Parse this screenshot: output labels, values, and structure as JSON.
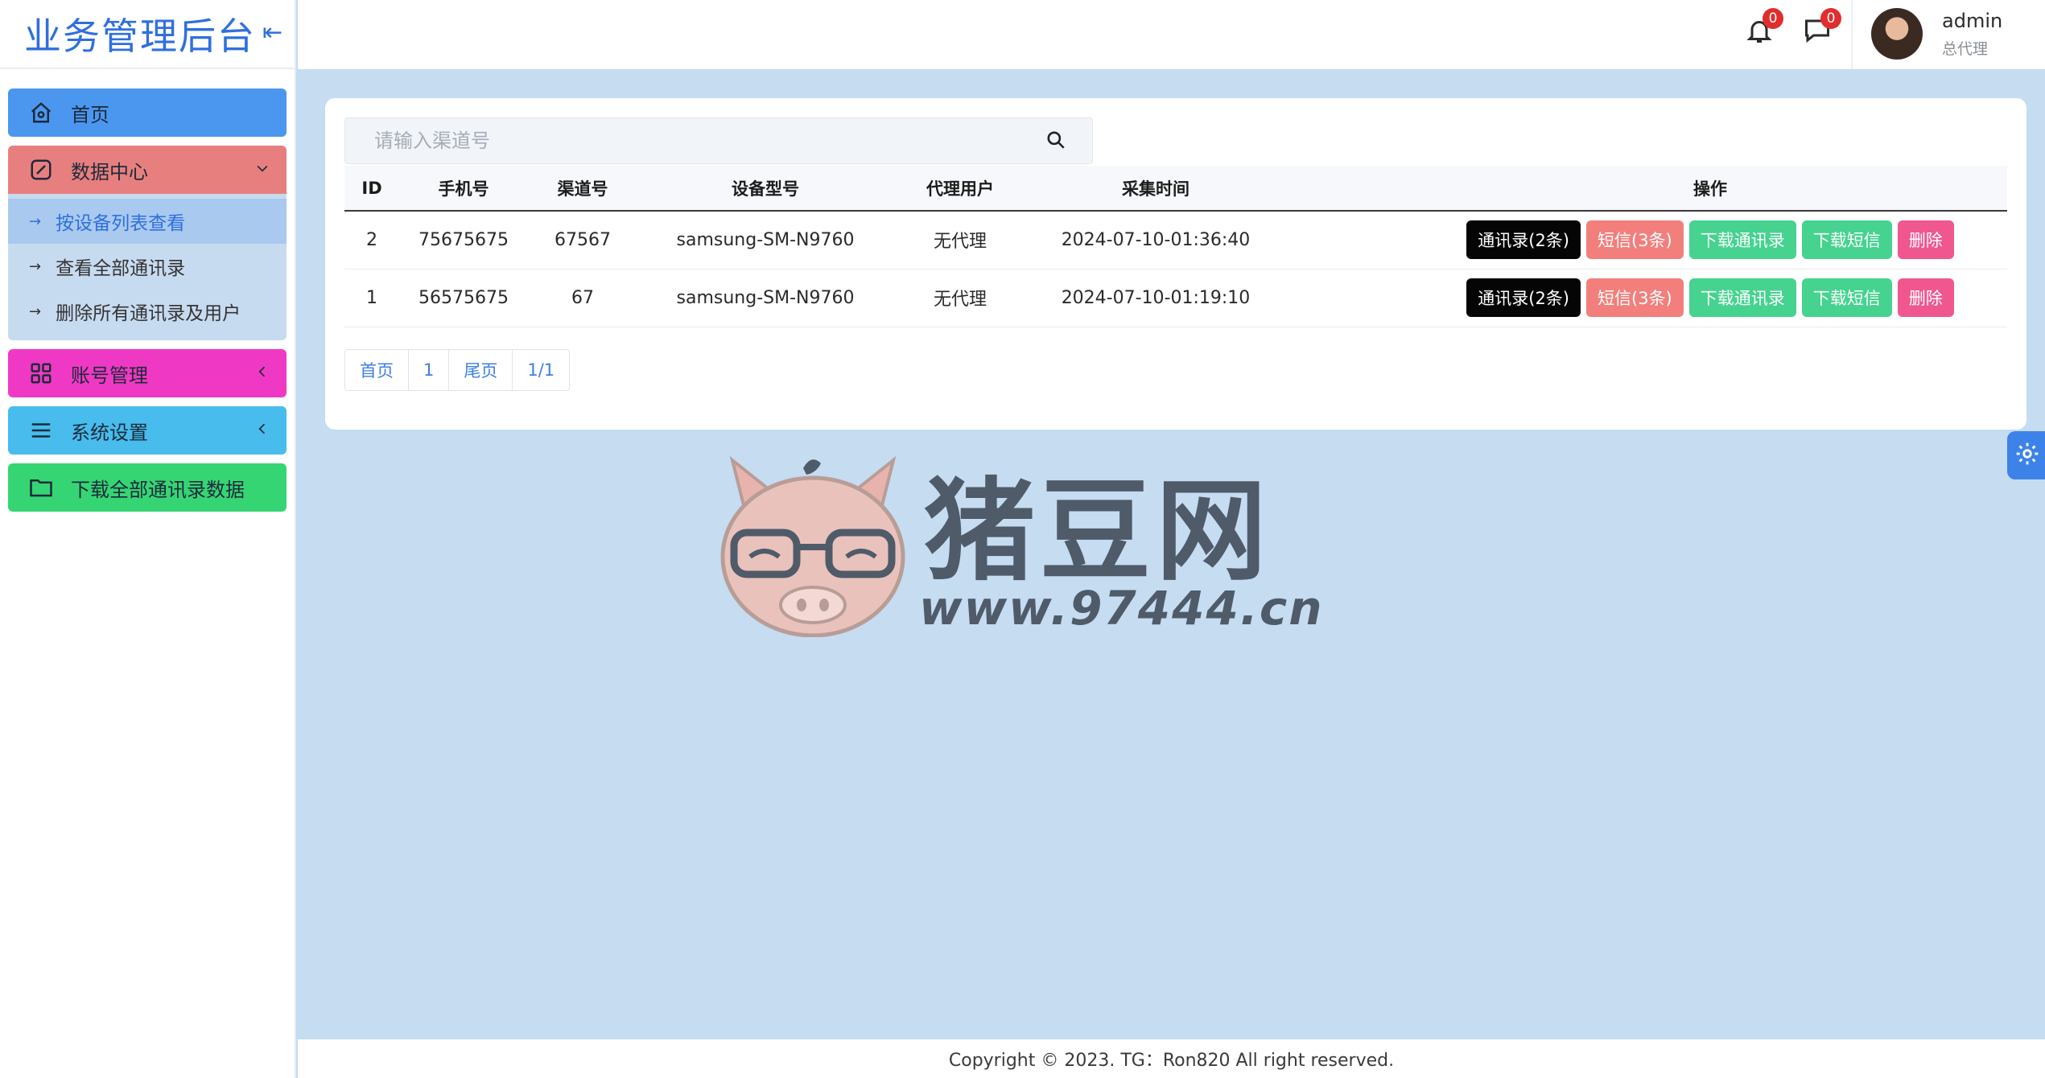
{
  "brand": {
    "title": "业务管理后台",
    "collapse_icon": "collapse-left-icon"
  },
  "sidebar": {
    "items": [
      {
        "label": "首页",
        "icon": "home-icon",
        "color": "#4b97ef"
      },
      {
        "label": "数据中心",
        "icon": "edit-square-icon",
        "color": "#e87f7f",
        "expanded": true,
        "children": [
          {
            "label": "按设备列表查看",
            "active": true
          },
          {
            "label": "查看全部通讯录"
          },
          {
            "label": "删除所有通讯录及用户"
          }
        ]
      },
      {
        "label": "账号管理",
        "icon": "grid-icon",
        "color": "#ef39c4"
      },
      {
        "label": "系统设置",
        "icon": "list-icon",
        "color": "#47bced"
      },
      {
        "label": "下载全部通讯录数据",
        "icon": "folder-icon",
        "color": "#36d574"
      }
    ]
  },
  "topbar": {
    "notifications": {
      "icon": "bell-icon",
      "count": "0"
    },
    "messages": {
      "icon": "chat-icon",
      "count": "0"
    },
    "user": {
      "name": "admin",
      "role": "总代理"
    }
  },
  "search": {
    "placeholder": "请输入渠道号",
    "value": ""
  },
  "table": {
    "headers": {
      "id": "ID",
      "phone": "手机号",
      "channel": "渠道号",
      "device": "设备型号",
      "agent": "代理用户",
      "time": "采集时间",
      "ops": "操作"
    },
    "rows": [
      {
        "id": "2",
        "phone": "75675675",
        "channel": "67567",
        "device": "samsung-SM-N9760",
        "agent": "无代理",
        "time": "2024-07-10-01:36:40",
        "contacts_btn": "通讯录(2条)",
        "sms_btn": "短信(3条)",
        "dl_contacts_btn": "下载通讯录",
        "dl_sms_btn": "下载短信",
        "delete_btn": "删除"
      },
      {
        "id": "1",
        "phone": "56575675",
        "channel": "67",
        "device": "samsung-SM-N9760",
        "agent": "无代理",
        "time": "2024-07-10-01:19:10",
        "contacts_btn": "通讯录(2条)",
        "sms_btn": "短信(3条)",
        "dl_contacts_btn": "下载通讯录",
        "dl_sms_btn": "下载短信",
        "delete_btn": "删除"
      }
    ]
  },
  "pager": {
    "first": "首页",
    "page": "1",
    "last": "尾页",
    "summary": "1/1"
  },
  "watermark": {
    "title": "猪豆网",
    "url": "www.97444.cn"
  },
  "footer": {
    "text": "Copyright © 2023. TG：Ron820 All right reserved."
  },
  "colors": {
    "accent": "#2f6fdf",
    "background": "#c5dcf1"
  }
}
